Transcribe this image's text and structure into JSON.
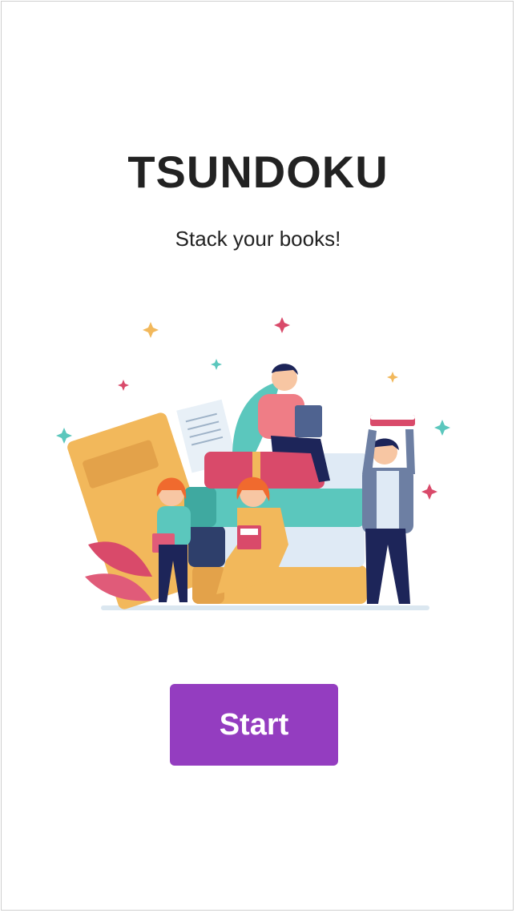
{
  "app": {
    "title": "TSUNDOKU",
    "tagline": "Stack your books!"
  },
  "actions": {
    "start_label": "Start"
  },
  "colors": {
    "accent": "#943dc0",
    "text": "#222222",
    "book_yellow": "#f2b85b",
    "book_red": "#d94a6a",
    "book_teal": "#5bc7bd",
    "book_navy": "#2e3f6b",
    "book_light": "#dfeaf5"
  }
}
